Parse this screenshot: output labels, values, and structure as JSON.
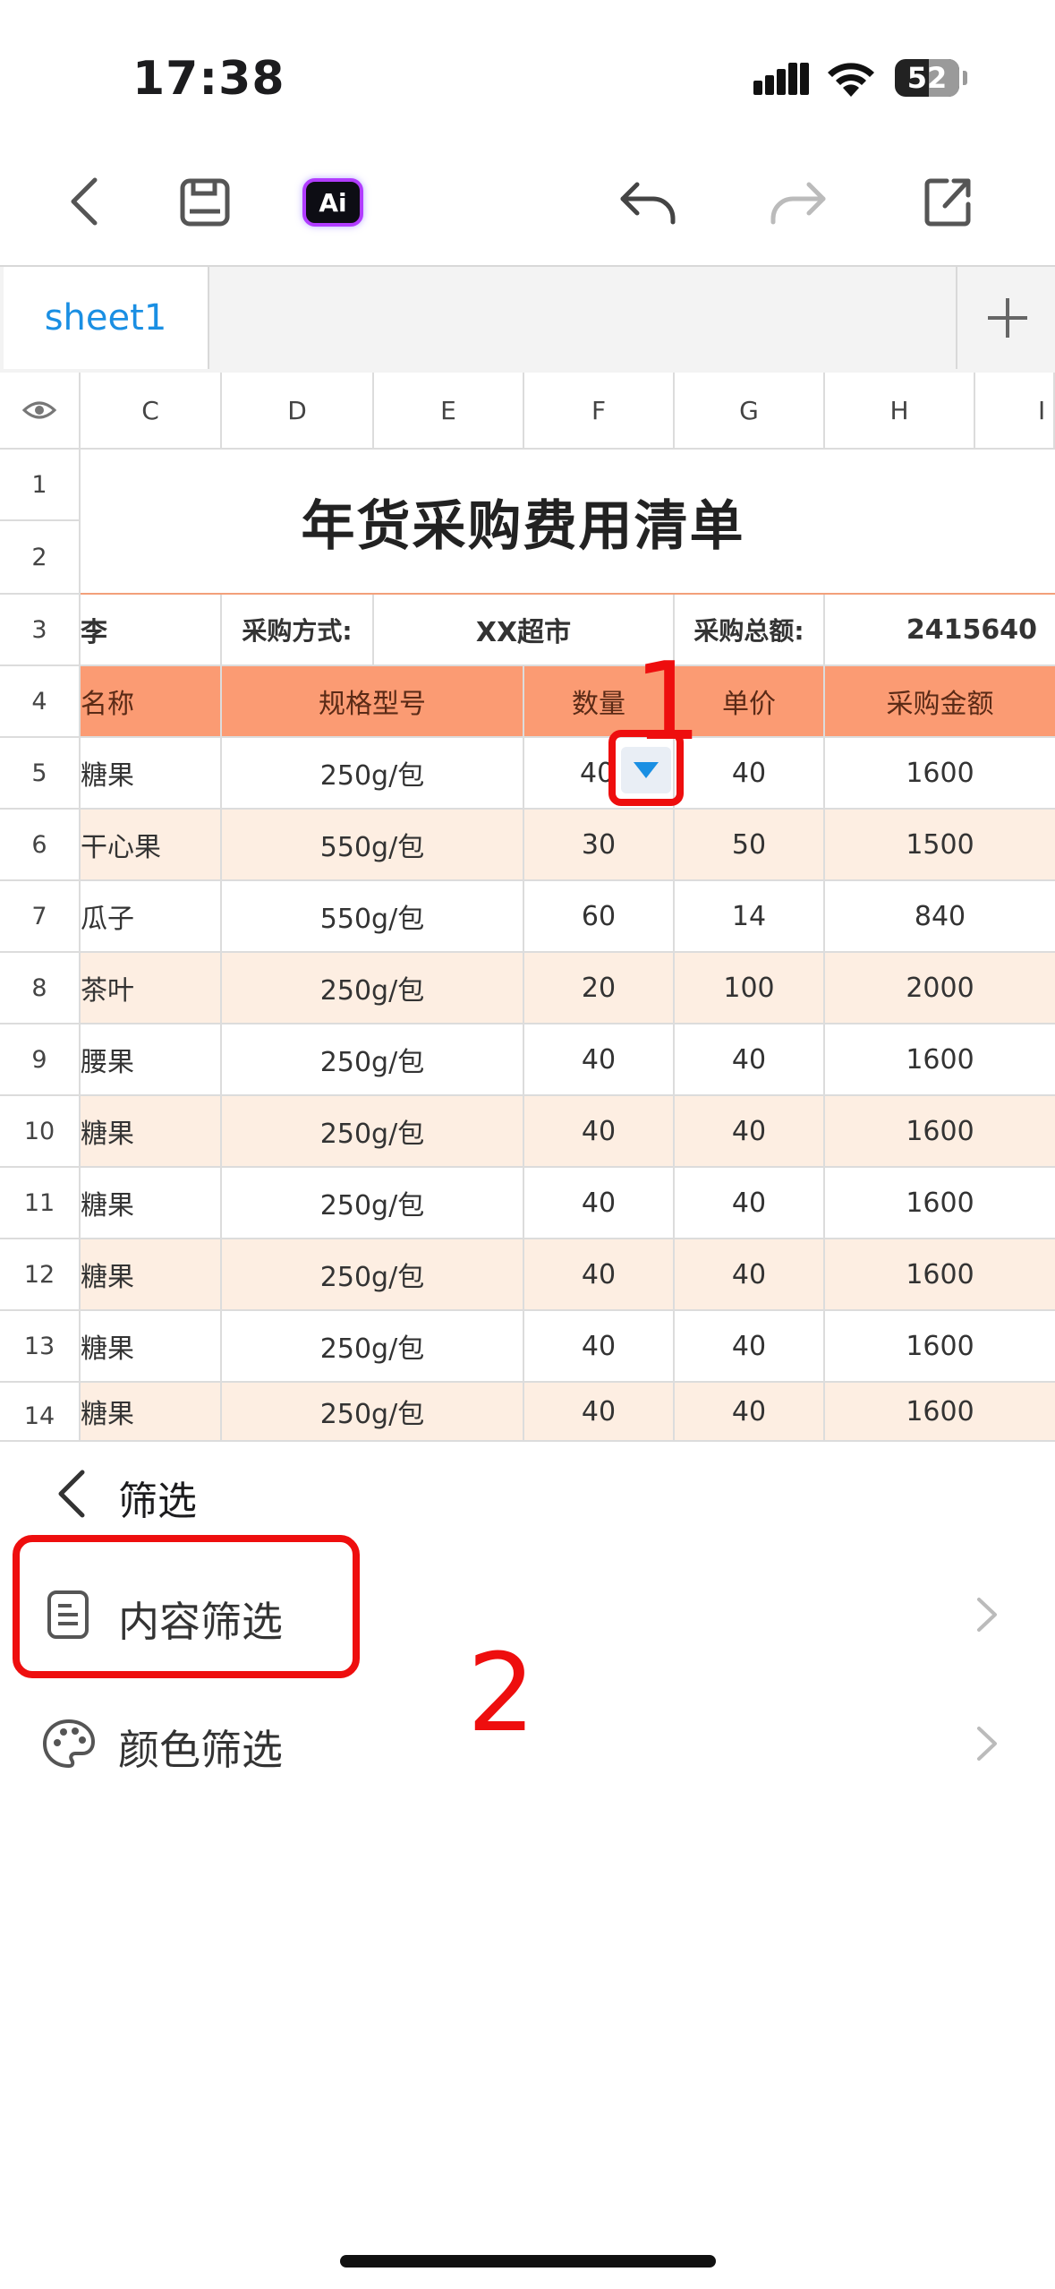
{
  "status_bar": {
    "time": "17:38",
    "battery": "52"
  },
  "toolbar": {
    "ai_label": "Ai",
    "icons": [
      "back-icon",
      "save-icon",
      "ai-icon",
      "undo-icon",
      "redo-icon",
      "share-icon"
    ]
  },
  "tabs": {
    "sheet_name": "sheet1",
    "add_label": "+"
  },
  "columns": [
    "C",
    "D",
    "E",
    "F",
    "G",
    "H",
    "I"
  ],
  "rows": [
    "1",
    "2",
    "3",
    "4",
    "5",
    "6",
    "7",
    "8",
    "9",
    "10",
    "11",
    "12",
    "13",
    "14"
  ],
  "sheet": {
    "title": "年货采购费用清单",
    "row3": {
      "c": "李",
      "d": "采购方式:",
      "ef": "XX超市",
      "g": "采购总额:",
      "h": "2415640"
    },
    "header": {
      "name": "名称",
      "spec": "规格型号",
      "qty": "数量",
      "price": "单价",
      "amount": "采购金额"
    },
    "data": [
      {
        "name": "糖果",
        "spec": "250g/包",
        "qty": "40",
        "price": "40",
        "amount": "1600"
      },
      {
        "name": "干心果",
        "spec": "550g/包",
        "qty": "30",
        "price": "50",
        "amount": "1500"
      },
      {
        "name": "瓜子",
        "spec": "550g/包",
        "qty": "60",
        "price": "14",
        "amount": "840"
      },
      {
        "name": "茶叶",
        "spec": "250g/包",
        "qty": "20",
        "price": "100",
        "amount": "2000"
      },
      {
        "name": "腰果",
        "spec": "250g/包",
        "qty": "40",
        "price": "40",
        "amount": "1600"
      },
      {
        "name": "糖果",
        "spec": "250g/包",
        "qty": "40",
        "price": "40",
        "amount": "1600"
      },
      {
        "name": "糖果",
        "spec": "250g/包",
        "qty": "40",
        "price": "40",
        "amount": "1600"
      },
      {
        "name": "糖果",
        "spec": "250g/包",
        "qty": "40",
        "price": "40",
        "amount": "1600"
      },
      {
        "name": "糖果",
        "spec": "250g/包",
        "qty": "40",
        "price": "40",
        "amount": "1600"
      },
      {
        "name": "糖果",
        "spec": "250g/包",
        "qty": "40",
        "price": "40",
        "amount": "1600"
      }
    ]
  },
  "annotations": {
    "step1": "1",
    "step2": "2"
  },
  "filter_panel": {
    "title": "筛选",
    "items": [
      {
        "label": "内容筛选",
        "icon": "document-icon"
      },
      {
        "label": "颜色筛选",
        "icon": "palette-icon"
      }
    ]
  },
  "colors": {
    "accent": "#1a8fe3",
    "header_fill": "#fb9b73",
    "alt_row": "#fdeee2",
    "annotation": "#ee0e0e"
  }
}
